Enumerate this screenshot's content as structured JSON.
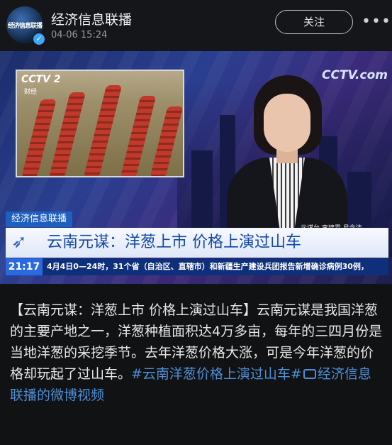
{
  "header": {
    "avatar_text": "经济信息联播",
    "account_name": "经济信息联播",
    "post_time": "04-06 15:24",
    "follow_label": "关注",
    "more_label": "•••"
  },
  "video": {
    "inset_logo": "CCTV 2",
    "inset_sub": "财经",
    "channel_logo": "CCTV.com",
    "reporter_credit": "元谋台  李建霖  易念洁",
    "program_label": "经济信息联播",
    "headline": "云南元谋：洋葱上市 价格上演过山车",
    "ticker_time": "21:17",
    "ticker_text": "4月4日0—24时，31个省（自治区、直辖市）和新疆生产建设兵团报告新增确诊病例30例，"
  },
  "caption": {
    "text": "【云南元谋：洋葱上市 价格上演过山车】云南元谋是我国洋葱的主要产地之一，洋葱种植面积达4万多亩，每年的三四月份是当地洋葱的采挖季节。去年洋葱价格大涨，可是今年洋葱的价格却玩起了过山车。",
    "hashtag": "#云南洋葱价格上演过山车#",
    "video_link": "经济信息联播的微博视频"
  },
  "colors": {
    "background": "#111214",
    "link": "#4f8fd8",
    "program_blue": "#1f5fbf"
  }
}
